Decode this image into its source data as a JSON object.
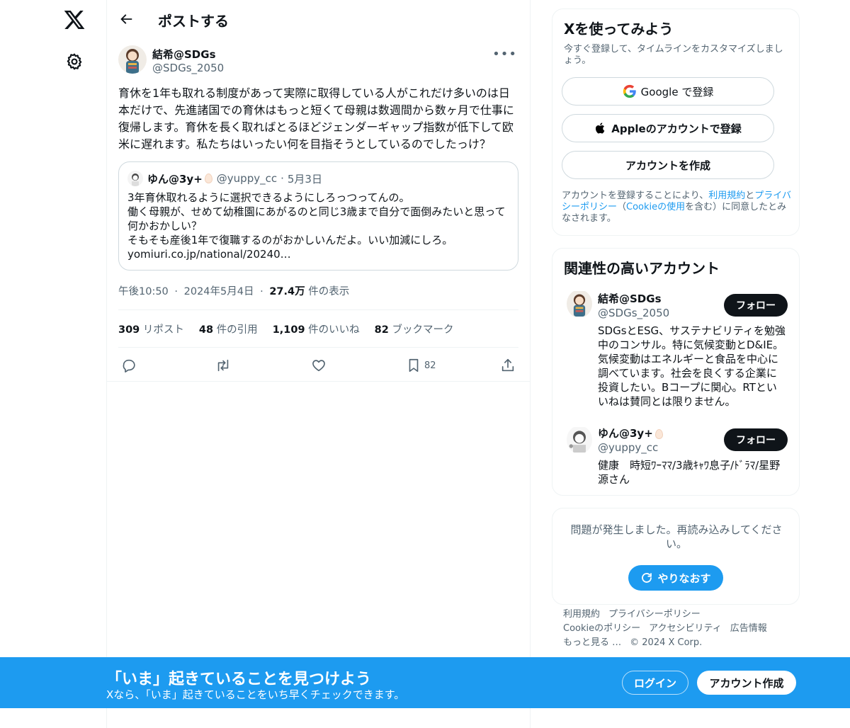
{
  "nav": {
    "logo_icon": "x-logo-icon",
    "settings_icon": "gear-icon"
  },
  "header": {
    "title": "ポストする"
  },
  "post": {
    "author_name": "結希@SDGs",
    "author_handle": "@SDGs_2050",
    "text": "育休を1年も取れる制度があって実際に取得している人がこれだけ多いのは日本だけで、先進諸国での育休はもっと短くて母親は数週間から数ヶ月で仕事に復帰します。育休を長く取ればとるほどジェンダーギャップ指数が低下して欧米に遅れます。私たちはいったい何を目指そうとしているのでしたっけ？",
    "quote": {
      "name": "ゆん@3y+",
      "handle": "@yuppy_cc",
      "sep": "·",
      "date": "5月3日",
      "text": "3年育休取れるように選択できるようにしろっつってんの。\n働く母親が、せめて幼稚園にあがるのと同じ3歳まで自分で面倒みたいと思って何かおかしい？\nそもそも産後1年で復職するのがおかしいんだよ。いい加減にしろ。\nyomiuri.co.jp/national/20240…"
    },
    "time": "午後10:50",
    "dot1": "·",
    "date": "2024年5月4日",
    "dot2": "·",
    "views": "27.4万",
    "views_label": "件の表示",
    "stats": {
      "reposts": "309",
      "reposts_label": "リポスト",
      "quotes": "48",
      "quotes_label": "件の引用",
      "likes": "1,109",
      "likes_label": "件のいいね",
      "bookmarks": "82",
      "bookmarks_label": "ブックマーク"
    },
    "bookmark_count": "82"
  },
  "signup_card": {
    "title": "Xを使ってみよう",
    "subtitle": "今すぐ登録して、タイムラインをカスタマイズしましょう。",
    "google_label": "Google で登録",
    "apple_label": "Appleのアカウントで登録",
    "create_label": "アカウントを作成",
    "legal_pre": "アカウントを登録することにより、",
    "legal_terms": "利用規約",
    "legal_and": "と",
    "legal_privacy": "プライバシーポリシー",
    "legal_mid": "（",
    "legal_cookie": "Cookieの使用",
    "legal_post": "を含む）に同意したとみなされます。"
  },
  "related": {
    "title": "関連性の高いアカウント",
    "accounts": [
      {
        "name": "結希@SDGs",
        "handle": "@SDGs_2050",
        "follow": "フォロー",
        "bio": "SDGsとESG、サステナビリティを勉強中のコンサル。特に気候変動とD&IE。気候変動はエネルギーと食品を中心に調べています。社会を良くする企業に投資したい。Bコープに関心。RTといいねは賛同とは限りません。"
      },
      {
        "name": "ゆん@3y+",
        "handle": "@yuppy_cc",
        "follow": "フォロー",
        "bio": "健康　時短ﾜｰﾏﾏ/3歳ｷｬﾜ息子/ﾄﾞﾗﾏ/星野源さん"
      }
    ]
  },
  "error_card": {
    "message": "問題が発生しました。再読み込みしてください。",
    "retry": "やりなおす"
  },
  "footer": {
    "terms": "利用規約",
    "privacy": "プライバシーポリシー",
    "cookie": "Cookieのポリシー",
    "accessibility": "アクセシビリティ",
    "ads": "広告情報",
    "more": "もっと見る …",
    "copyright": "© 2024 X Corp."
  },
  "banner": {
    "title": "「いま」起きていることを見つけよう",
    "subtitle": "Xなら、「いま」起きていることをいち早くチェックできます。",
    "login": "ログイン",
    "signup": "アカウント作成"
  },
  "colors": {
    "accent": "#1d9bf0",
    "text": "#0f1419",
    "muted": "#536471",
    "border": "#eff3f4"
  }
}
